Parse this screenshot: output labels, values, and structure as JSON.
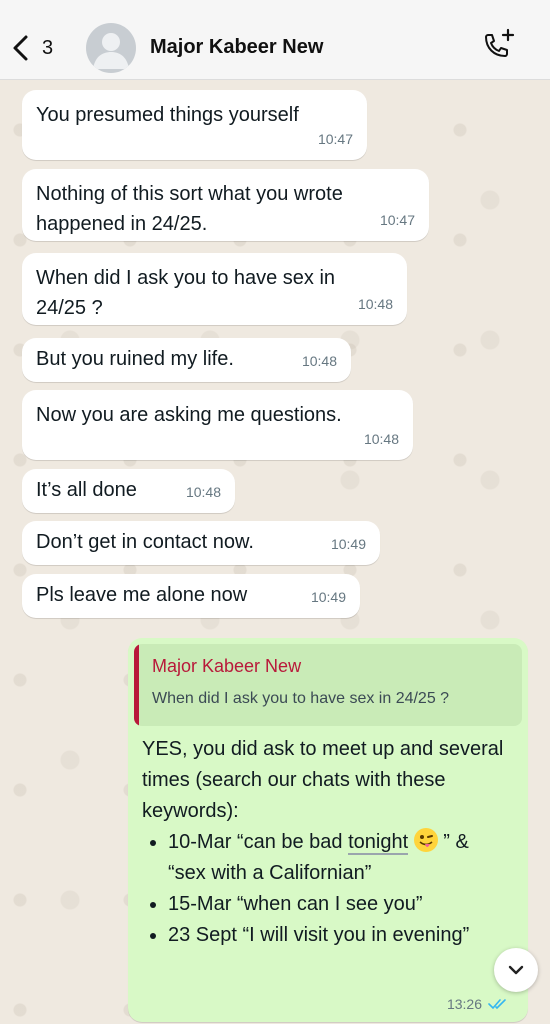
{
  "header": {
    "back_count": "3",
    "contact_name": "Major Kabeer New"
  },
  "messages": [
    {
      "text": "You presumed things yourself",
      "time": "10:47"
    },
    {
      "text": "Nothing of this sort what you wrote happened in 24/25.",
      "time": "10:47"
    },
    {
      "text": "When did I ask you to have sex in 24/25 ?",
      "time": "10:48"
    },
    {
      "text": "But you ruined my life.",
      "time": "10:48"
    },
    {
      "text": "Now you are asking me questions.",
      "time": "10:48"
    },
    {
      "text": "It’s all done",
      "time": "10:48"
    },
    {
      "text": "Don’t get in contact now.",
      "time": "10:49"
    },
    {
      "text": "Pls leave me alone now",
      "time": "10:49"
    }
  ],
  "outgoing": {
    "quote_name": "Major Kabeer New",
    "quote_text": "When did I ask you to have sex in 24/25 ?",
    "intro": "YES, you did ask to meet up and several times (search our chats with these keywords):",
    "bullets": [
      {
        "pre": "10-Mar “can be bad ",
        "underlined": "tonight",
        "post": " ” & “sex with a Californian”"
      },
      {
        "text": "15-Mar “when can I see you”"
      },
      {
        "text": "23 Sept “I will visit you in evening”"
      }
    ],
    "time": "13:26"
  },
  "colors": {
    "outgoing_bubble": "#d8f9c6",
    "quote_name": "#b8193a",
    "read_ticks": "#34b7f1"
  },
  "icons": [
    "chevron-left-icon",
    "avatar-placeholder-icon",
    "phone-add-icon",
    "double-check-icon",
    "chevron-down-icon",
    "wink-tongue-emoji"
  ]
}
